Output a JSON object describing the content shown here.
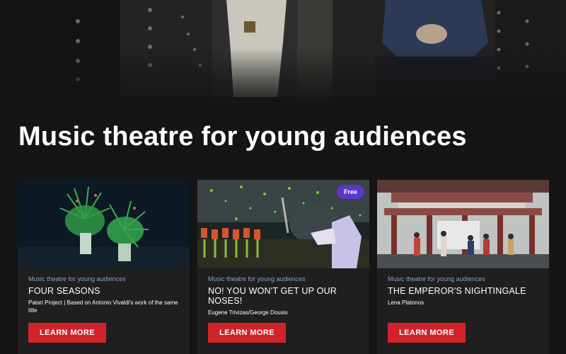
{
  "section": {
    "title": "Music theatre for young audiences"
  },
  "cards": [
    {
      "category": "Music theatre for young audiences",
      "title": "FOUR SEASONS",
      "subtitle": "Patari Project | Based on Antonio Vivaldi's work of the same title",
      "button_label": "LEARN MORE",
      "badge": null,
      "image": "dancers-in-green-costumes"
    },
    {
      "category": "Music theatre for young audiences",
      "title": "NO! YOU WON'T GET UP OUR NOSES!",
      "subtitle": "Eugene Trivizas/George Dousis",
      "button_label": "LEARN MORE",
      "badge": "Free",
      "image": "stage-with-green-confetti"
    },
    {
      "category": "Music theatre for young audiences",
      "title": "THE EMPEROR'S NIGHTINGALE",
      "subtitle": "Lena Platonos",
      "button_label": "LEARN MORE",
      "badge": null,
      "image": "chinese-palace-stage-set"
    }
  ],
  "colors": {
    "background": "#151515",
    "card": "#1f1f1f",
    "button": "#d2232a",
    "badge": "#5a37c9",
    "category": "#8aa0bf"
  }
}
